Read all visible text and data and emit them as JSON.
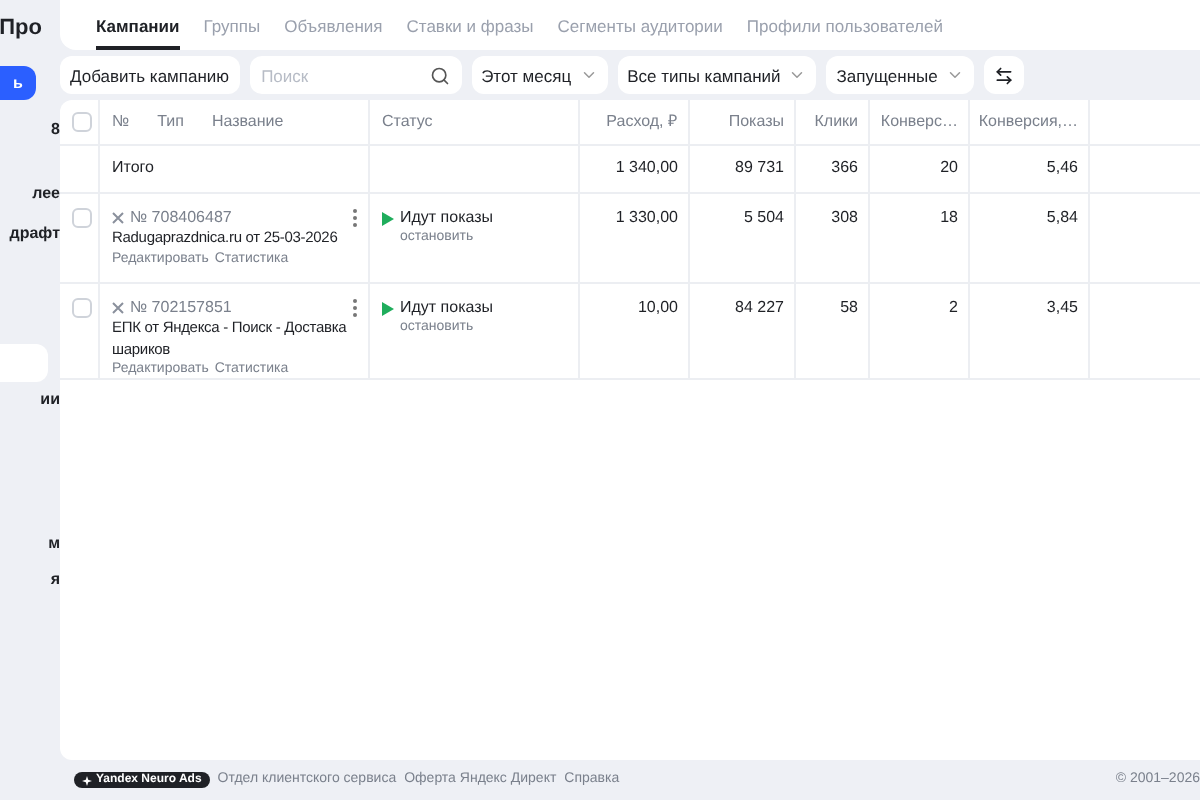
{
  "sidebar": {
    "title": "Про",
    "button": "ь",
    "items": [
      {
        "label": "8",
        "selected": false
      },
      {
        "label": "лее",
        "selected": false
      },
      {
        "label": "драфт",
        "selected": false
      },
      {
        "selected": true
      },
      {
        "label": "ии",
        "selected": false
      },
      {
        "label": "м",
        "selected": false
      },
      {
        "label": "я",
        "selected": false
      }
    ]
  },
  "tabs": [
    {
      "label": "Кампании",
      "selected": true
    },
    {
      "label": "Группы",
      "selected": false
    },
    {
      "label": "Объявления",
      "selected": false
    },
    {
      "label": "Ставки и фразы",
      "selected": false
    },
    {
      "label": "Сегменты аудитории",
      "selected": false
    },
    {
      "label": "Профили пользователей",
      "selected": false
    }
  ],
  "toolbar": {
    "add_button": "Добавить кампанию",
    "search": {
      "placeholder": "Поиск"
    },
    "filters": [
      "Этот месяц",
      "Все типы кампаний",
      "Запущенные"
    ]
  },
  "table": {
    "header_checked": false,
    "columns": [
      "№",
      "Тип",
      "Название",
      "Статус",
      "Расход, ₽",
      "Показы",
      "Клики",
      "Конверс…",
      "Конверсия,…"
    ],
    "rows": [
      {
        "kind": "total",
        "label": "Итого",
        "metrics": [
          "1 340,00",
          "89 731",
          "366",
          "20",
          "5,46"
        ]
      },
      {
        "kind": "campaign",
        "checked": false,
        "number": "№ 708406487",
        "name": "Radugaprazdnica.ru от 25-03-2026",
        "actions": [
          "Редактировать",
          "Статистика"
        ],
        "status": "Идут показы",
        "status_action": "остановить",
        "metrics": [
          "1 330,00",
          "5 504",
          "308",
          "18",
          "5,84"
        ]
      },
      {
        "kind": "campaign",
        "checked": false,
        "number": "№ 702157851",
        "name": "ЕПК от Яндекса - Поиск - Доставка шариков",
        "actions": [
          "Редактировать",
          "Статистика"
        ],
        "status": "Идут показы",
        "status_action": "остановить",
        "metrics": [
          "10,00",
          "84 227",
          "58",
          "2",
          "3,45"
        ]
      }
    ]
  },
  "footer": {
    "badge": "Yandex Neuro Ads",
    "links": [
      "Отдел клиентского сервиса",
      "Оферта Яндекс Директ",
      "Справка"
    ],
    "copyright": "© 2001–2026"
  }
}
